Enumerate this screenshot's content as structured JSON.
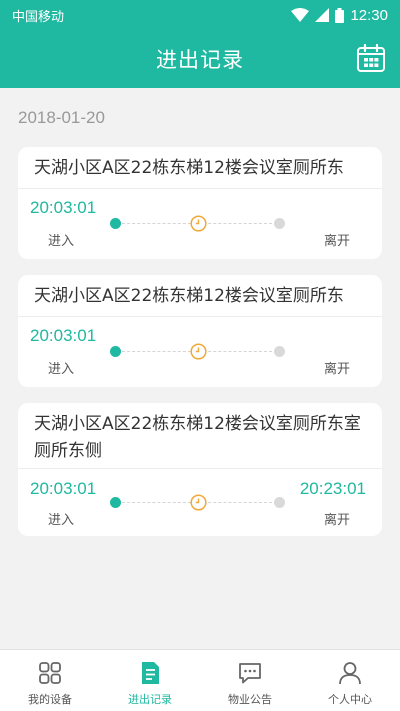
{
  "status_bar": {
    "carrier": "中国移动",
    "time": "12:30"
  },
  "header": {
    "title": "进出记录"
  },
  "colors": {
    "accent": "#1fb8a0",
    "inactive_dot": "#d9d9d9",
    "clock": "#f0a838"
  },
  "date": "2018-01-20",
  "records": [
    {
      "location": "天湖小区A区22栋东梯12楼会议室厕所东",
      "entry_time": "20:03:01",
      "entry_label": "进入",
      "exit_time": "",
      "exit_label": "离开"
    },
    {
      "location": "天湖小区A区22栋东梯12楼会议室厕所东",
      "entry_time": "20:03:01",
      "entry_label": "进入",
      "exit_time": "",
      "exit_label": "离开"
    },
    {
      "location": "天湖小区A区22栋东梯12楼会议室厕所东室厕所东侧",
      "entry_time": "20:03:01",
      "entry_label": "进入",
      "exit_time": "20:23:01",
      "exit_label": "离开"
    }
  ],
  "tabs": [
    {
      "label": "我的设备",
      "icon": "grid-icon",
      "active": false
    },
    {
      "label": "进出记录",
      "icon": "document-icon",
      "active": true
    },
    {
      "label": "物业公告",
      "icon": "message-icon",
      "active": false
    },
    {
      "label": "个人中心",
      "icon": "user-icon",
      "active": false
    }
  ]
}
